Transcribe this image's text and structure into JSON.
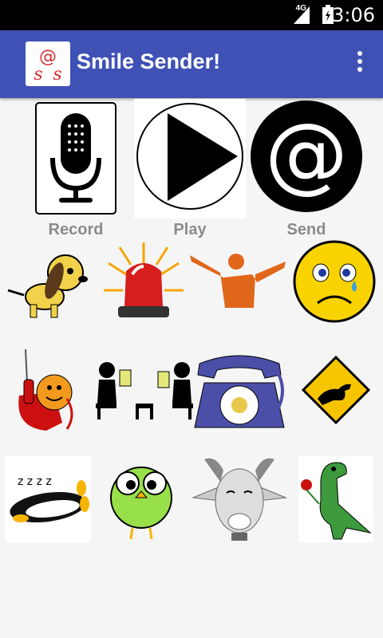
{
  "status_bar": {
    "network": "4G",
    "time": "3:06"
  },
  "app_bar": {
    "title": "Smile Sender!",
    "logo_text": "@\nss"
  },
  "actions": [
    {
      "label": "Record",
      "icon": "microphone-icon"
    },
    {
      "label": "Play",
      "icon": "play-icon"
    },
    {
      "label": "Send",
      "icon": "at-sign-icon"
    }
  ],
  "smiles": [
    {
      "name": "dog",
      "icon": "dog-icon"
    },
    {
      "name": "alarm",
      "icon": "siren-icon"
    },
    {
      "name": "cheer",
      "icon": "cheering-person-icon"
    },
    {
      "name": "sad",
      "icon": "crying-face-icon"
    },
    {
      "name": "phone-smiley",
      "icon": "phone-smiley-icon"
    },
    {
      "name": "meeting",
      "icon": "meeting-people-icon"
    },
    {
      "name": "telephone",
      "icon": "rotary-telephone-icon"
    },
    {
      "name": "kangaroo",
      "icon": "kangaroo-sign-icon"
    },
    {
      "name": "sleeping",
      "icon": "sleeping-penguin-icon"
    },
    {
      "name": "owl",
      "icon": "owl-icon"
    },
    {
      "name": "goat",
      "icon": "goat-icon"
    },
    {
      "name": "dinosaur",
      "icon": "dinosaur-flower-icon"
    }
  ]
}
